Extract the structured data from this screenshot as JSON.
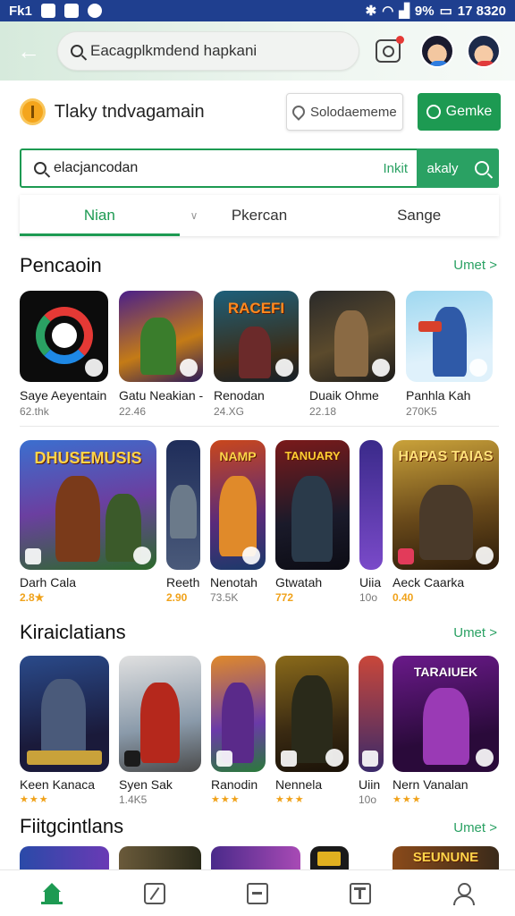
{
  "status_bar": {
    "left_text": "Fk1",
    "battery_text": "9%",
    "time_text": "17 8320"
  },
  "header": {
    "search_text": "Eacagplkmdend hapkani",
    "icons": [
      "back-arrow-icon",
      "camera-icon",
      "search-icon"
    ]
  },
  "promo": {
    "text": "Tlaky tndvagamain",
    "location_button": "Solodaememe",
    "green_button": "Gemke"
  },
  "search": {
    "value": "elacjancodan",
    "hint": "Inkit",
    "go_label": "akaly"
  },
  "tabs": [
    {
      "label": "Nian",
      "active": true
    },
    {
      "label": "Pkercan",
      "active": false
    },
    {
      "label": "Sange",
      "active": false
    }
  ],
  "section1": {
    "title": "Pencaoin",
    "more": "Umet >",
    "apps": [
      {
        "name": "Saye Aeyentain",
        "meta": "62.thk"
      },
      {
        "name": "Gatu Neakian -",
        "meta": "22.46"
      },
      {
        "name": "Renodan",
        "meta": "24.XG"
      },
      {
        "name": "Duaik Ohme",
        "meta": "22.18"
      },
      {
        "name": "Panhla Kah",
        "meta": "270K5"
      }
    ]
  },
  "section2": {
    "banners": [
      "DHUSEMUSIS",
      "NAMP",
      "TANUARY",
      "HAPAS TAIAS"
    ],
    "apps": [
      {
        "name": "Darh Cala",
        "meta": "2.8★"
      },
      {
        "name": "Reeth",
        "meta": "2.90"
      },
      {
        "name": "Nenotah",
        "meta": "73.5K"
      },
      {
        "name": "Gtwatah",
        "meta": "772"
      },
      {
        "name": "Uiia",
        "meta": "10o"
      },
      {
        "name": "Aeck Caarka",
        "meta": "0.40"
      }
    ]
  },
  "section3": {
    "title": "Kiraiclatians",
    "more": "Umet >",
    "banners": [
      "",
      "",
      "",
      "",
      "",
      "TARAIUEK"
    ],
    "apps": [
      {
        "name": "Keen Kanaca",
        "meta": "★★★"
      },
      {
        "name": "Syen Sak",
        "meta": "1.4K5"
      },
      {
        "name": "Ranodin",
        "meta": "★★★"
      },
      {
        "name": "Nennela",
        "meta": "★★★"
      },
      {
        "name": "Uiin",
        "meta": "10o"
      },
      {
        "name": "Nern Vanalan",
        "meta": "★★★"
      }
    ]
  },
  "section4": {
    "title": "Fiitgcintlans",
    "more": "Umet >",
    "banners": [
      "",
      "",
      "",
      "",
      "SEUNUNE"
    ]
  },
  "bottom_nav": [
    {
      "name": "home-icon"
    },
    {
      "name": "edit-icon"
    },
    {
      "name": "library-icon"
    },
    {
      "name": "notes-icon"
    },
    {
      "name": "profile-icon"
    }
  ],
  "colors": {
    "accent": "#1d9a52",
    "status_bar": "#1f3f8f"
  }
}
